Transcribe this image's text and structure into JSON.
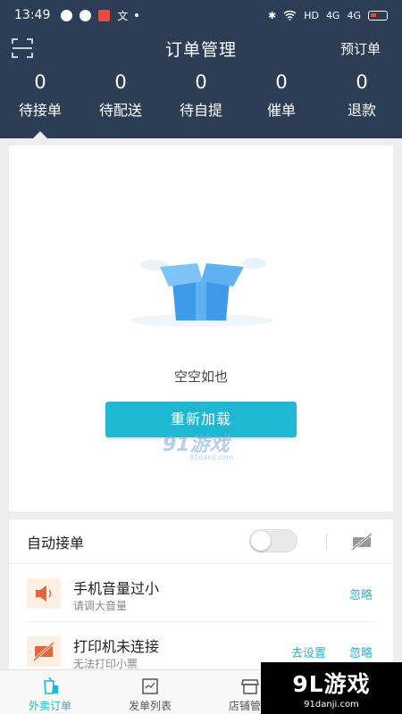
{
  "status_bar": {
    "time": "13:49",
    "network": "HD",
    "signal1": "4G",
    "signal2": "4G"
  },
  "header": {
    "title": "订单管理",
    "right_action": "预订单"
  },
  "stats": [
    {
      "count": "0",
      "label": "待接单"
    },
    {
      "count": "0",
      "label": "待配送"
    },
    {
      "count": "0",
      "label": "待自提"
    },
    {
      "count": "0",
      "label": "催单"
    },
    {
      "count": "0",
      "label": "退款"
    }
  ],
  "empty_state": {
    "message": "空空如也",
    "reload_label": "重新加载",
    "watermark_main": "91游戏",
    "watermark_sub": "91danji.com"
  },
  "settings": {
    "auto_accept_label": "自动接单",
    "auto_accept_on": false,
    "alerts": [
      {
        "title": "手机音量过小",
        "subtitle": "请调大音量",
        "actions": [
          "忽略"
        ]
      },
      {
        "title": "打印机未连接",
        "subtitle": "无法打印小票",
        "actions": [
          "去设置",
          "忽略"
        ]
      }
    ]
  },
  "tabbar": {
    "tabs": [
      {
        "label": "外卖订单",
        "icon": "takeout-cup-icon",
        "active": true
      },
      {
        "label": "发单列表",
        "icon": "list-doc-icon",
        "active": false
      },
      {
        "label": "店铺管理",
        "icon": "store-icon",
        "active": false
      }
    ]
  },
  "watermark": {
    "main": "9L游戏",
    "sub": "91danji.com"
  },
  "colors": {
    "header_bg": "#2c3e55",
    "accent": "#1fb8d3",
    "alert_icon_bg": "#fdf0e3",
    "alert_icon": "#e8643c"
  }
}
